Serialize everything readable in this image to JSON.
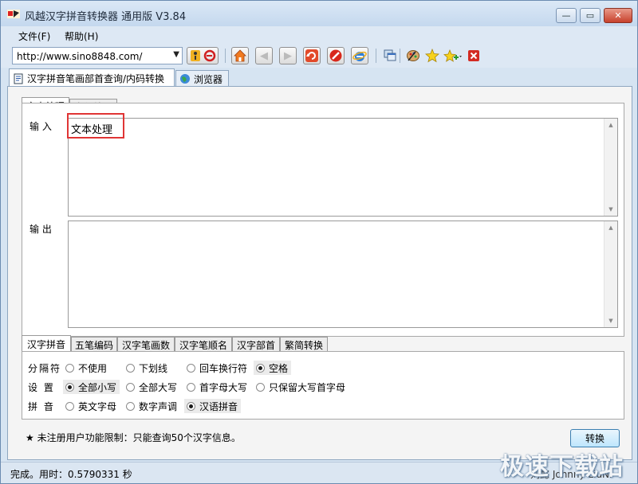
{
  "window": {
    "title": "风越汉字拼音转换器 通用版 V3.84",
    "buttons": {
      "minimize": "—",
      "maximize": "▭",
      "close": "✕"
    }
  },
  "menu": {
    "items": [
      "文件(F)",
      "帮助(H)"
    ]
  },
  "toolbar": {
    "url": "http://www.sino8848.com/",
    "icons": [
      "go-icon",
      "home-icon",
      "back-icon",
      "forward-icon",
      "refresh-icon",
      "stop-icon",
      "ie-icon",
      "window-icon",
      "palette-icon",
      "favorite-star-icon",
      "add-favorite-icon",
      "delete-icon"
    ]
  },
  "main_tabs": [
    "汉字拼音笔画部首查询/内码转换",
    "浏览器"
  ],
  "sub_tabs": [
    "文本处理",
    "文件处理"
  ],
  "labels": {
    "input": "输 入",
    "output": "输 出"
  },
  "input_text": "文本处理",
  "output_text": "",
  "option_tabs": [
    "汉字拼音",
    "五笔编码",
    "汉字笔画数",
    "汉字笔顺名",
    "汉字部首",
    "繁简转换"
  ],
  "options": {
    "separator": {
      "label": "分隔符",
      "choices": [
        "不使用",
        "下划线",
        "回车换行符",
        "空格"
      ],
      "selected": "空格"
    },
    "case": {
      "label": "设 置",
      "choices": [
        "全部小写",
        "全部大写",
        "首字母大写",
        "只保留大写首字母"
      ],
      "selected": "全部小写"
    },
    "pinyin": {
      "label": "拼 音",
      "choices": [
        "英文字母",
        "数字声调",
        "汉语拼音"
      ],
      "selected": "汉语拼音"
    }
  },
  "notice": "★ 未注册用户功能限制：只能查询50个汉字信息。",
  "convert_button": "转换",
  "status": {
    "text": "完成。用时：0.5790331 秒",
    "author": "刘懿 Johnny LiuNi"
  },
  "watermark": "极速下载站",
  "colors": {
    "accent_red": "#e03535",
    "title_bar": "#c4d8ee",
    "convert_button": "#bee6fd"
  }
}
